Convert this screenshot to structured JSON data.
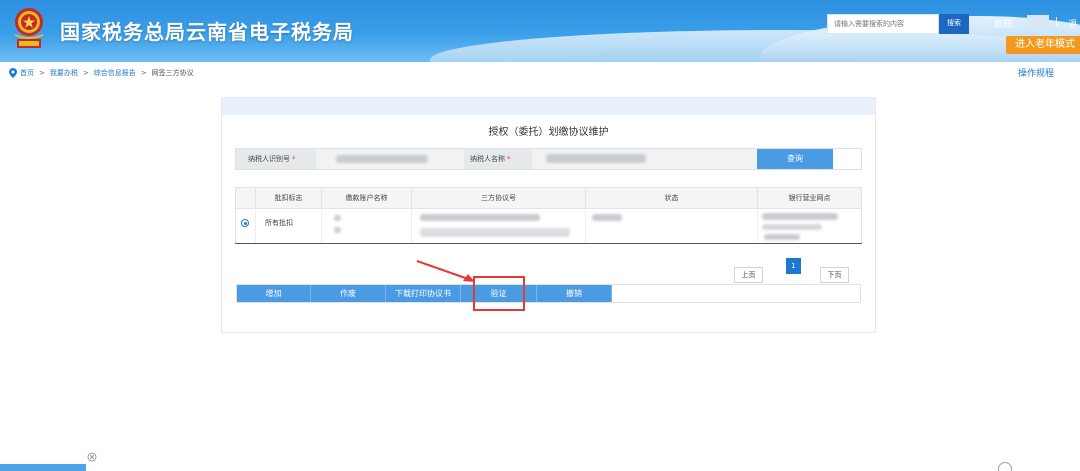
{
  "header": {
    "site_title": "国家税务总局云南省电子税务局",
    "search_placeholder": "请输入需要搜索的内容",
    "search_button": "搜索",
    "welcome": "欢迎,",
    "divider": "|",
    "logout": "退",
    "elder_mode": "进入老年模式"
  },
  "breadcrumb": {
    "items": [
      "首页",
      "我要办税",
      "综合信息报告",
      "网签三方协议"
    ],
    "separator": ">"
  },
  "help_link": "操作规程",
  "form": {
    "title": "授权（委托）划缴协议维护",
    "taxpayer_id_label": "纳税人识别号",
    "taxpayer_name_label": "纳税人名称",
    "required_mark": "*",
    "query_button": "查询"
  },
  "table": {
    "columns": [
      "批扣标志",
      "缴款账户名称",
      "三方协议号",
      "状态",
      "银行营业网点"
    ],
    "rows": [
      {
        "批扣标志": "所有批扣"
      }
    ]
  },
  "pager": {
    "prev": "上页",
    "current_page": "1",
    "next": "下页"
  },
  "actions": [
    "增加",
    "作废",
    "下载打印协议书",
    "验证",
    "撤销"
  ],
  "colors": {
    "brand_blue": "#3a9fea",
    "button_blue": "#4a9be4",
    "link_blue": "#1e78d2",
    "elder_orange": "#f39a1e",
    "highlight_red": "#e53935"
  },
  "icons": {
    "breadcrumb": "location-pin-icon",
    "emblem": "tax-emblem-icon",
    "annotation": "red-arrow-icon",
    "close": "close-circle-icon"
  }
}
